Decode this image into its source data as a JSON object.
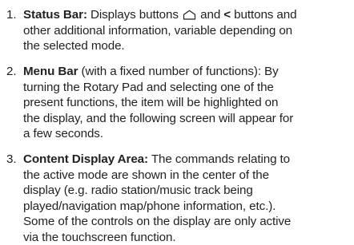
{
  "items": [
    {
      "number": "1.",
      "title": "Status Bar:",
      "text_a": " Displays buttons ",
      "home_icon": "home-icon",
      "text_b": " and ",
      "back_symbol": "<",
      "text_c": " buttons and",
      "lines": [
        "other additional information, variable depending on",
        "the selected mode."
      ]
    },
    {
      "number": "2.",
      "title": "Menu Bar",
      "first_rest": " (with a fixed number of functions): By",
      "lines": [
        "turning the Rotary Pad and selecting one of the",
        "present functions, the item will be highlighted on",
        "the display, and the following screen will appear for",
        "a few seconds."
      ]
    },
    {
      "number": "3.",
      "title": "Content Display Area:",
      "first_rest": " The commands relating to",
      "lines": [
        "the active mode are shown in the center of the",
        "display (e.g. radio station/music track being",
        "played/navigation map/phone information, etc.).",
        "Some of the controls on the display are only active",
        "via the touchscreen function."
      ]
    }
  ]
}
